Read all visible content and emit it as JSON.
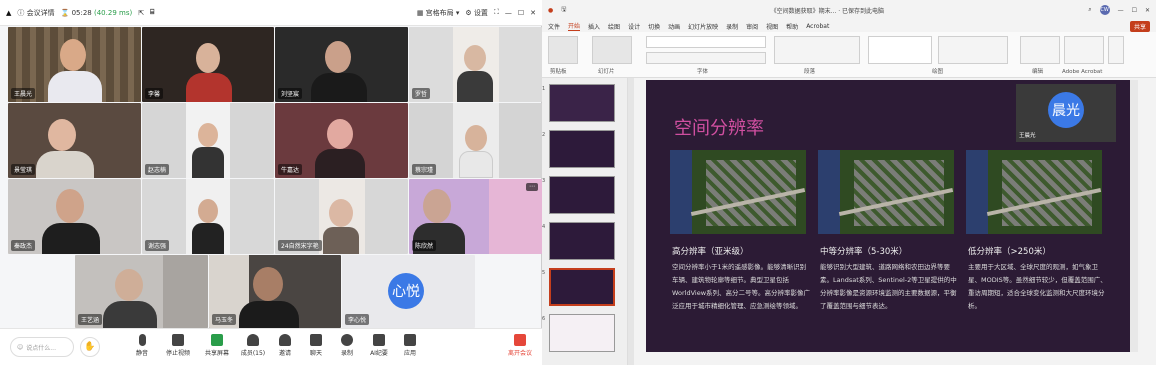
{
  "meeting": {
    "titlebar": {
      "details": "会议详情",
      "timer": "05:28",
      "network": "(40.29 ms)",
      "layout": "宫格布局",
      "settings": "设置"
    },
    "participants": [
      {
        "name": "王晨光"
      },
      {
        "name": "李馨"
      },
      {
        "name": "刘坚宸"
      },
      {
        "name": "罗哲"
      },
      {
        "name": "景莹琪"
      },
      {
        "name": "赵志楠"
      },
      {
        "name": "牛嘉达"
      },
      {
        "name": "蔡宗瑾"
      },
      {
        "name": "秦政杰"
      },
      {
        "name": "谢志强"
      },
      {
        "name": "24自然宋字艳"
      },
      {
        "name": "陈欣然"
      },
      {
        "name": "王艺涵"
      },
      {
        "name": "马玉冬"
      },
      {
        "name": "李心悦",
        "avatar_text": "心悦"
      }
    ],
    "toolbar": {
      "say_placeholder": "说点什么...",
      "buttons": [
        "静音",
        "停止视频",
        "共享屏幕",
        "成员(15)",
        "邀请",
        "聊天",
        "录制",
        "AI纪要",
        "应用"
      ],
      "leave": "离开会议"
    },
    "colors": {
      "accent": "#3b79e6",
      "leave": "#e5473a"
    }
  },
  "ppt": {
    "title": "《空间数据获取》期末... · 已保存到此电脑",
    "tabs": [
      "文件",
      "开始",
      "插入",
      "绘图",
      "设计",
      "切换",
      "动画",
      "幻灯片放映",
      "录制",
      "审阅",
      "视图",
      "帮助",
      "Acrobat"
    ],
    "active_tab": "开始",
    "ribbon_groups": [
      "剪贴板",
      "幻灯片",
      "字体",
      "段落",
      "绘图",
      "编辑",
      "Adobe Acrobat"
    ],
    "share_button": "共享",
    "thumb_numbers": [
      "1",
      "2",
      "3",
      "4",
      "5",
      "6"
    ],
    "slide": {
      "title": "空间分辨率",
      "presenter_avatar": "晨光",
      "presenter_name": "王晨光",
      "columns": [
        {
          "heading": "高分辨率（亚米级）",
          "text": "空间分辨率小于1米的遥感影像。能够清晰识别车辆、建筑物轮廓等细节。典型卫星包括WorldView系列、高分二号等。高分辨率影像广泛应用于城市精细化管理、应急测绘等领域。"
        },
        {
          "heading": "中等分辨率（5-30米）",
          "text": "能够识别大型建筑、道路网络和农田边界等要素。Landsat系列、Sentinel-2等卫星提供的中分辨率影像是资源环境监测的主要数据源，平衡了覆盖范围与细节表达。"
        },
        {
          "heading": "低分辨率（>250米）",
          "text": "主要用于大区域、全球尺度的观测，如气象卫星、MODIS等。虽然细节较少，但覆盖范围广、重访周期短，适合全球变化监测和大尺度环境分析。"
        }
      ]
    },
    "colors": {
      "slide_bg": "#2c1b35",
      "title": "#d04fa0",
      "brand": "#c43e1c"
    }
  }
}
